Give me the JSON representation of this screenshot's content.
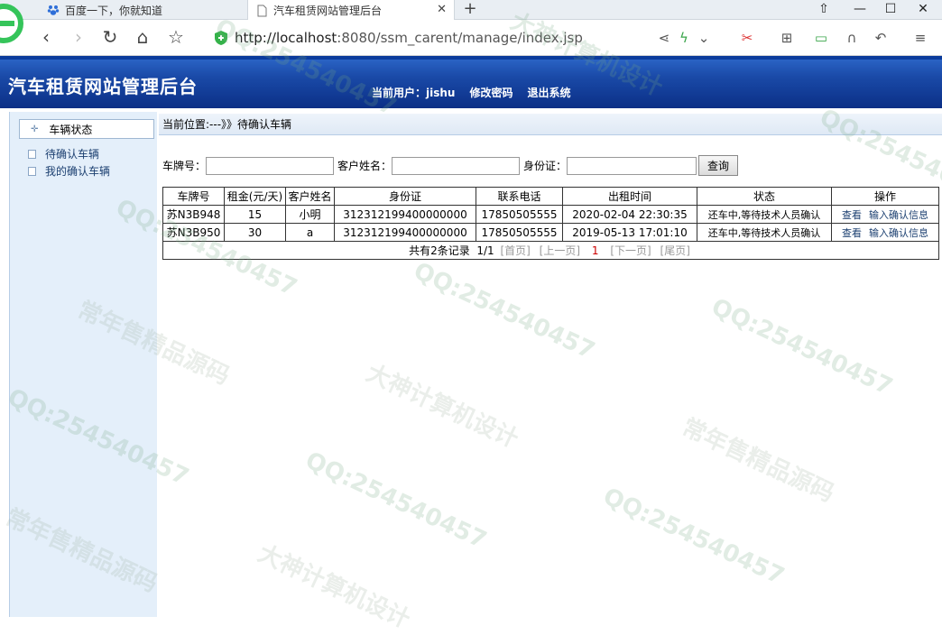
{
  "browser": {
    "tabs": [
      {
        "label": "百度一下，你就知道"
      },
      {
        "label": "汽车租赁网站管理后台"
      }
    ],
    "url": "http://localhost:8080/ssm_carent/manage/index.jsp",
    "url_host": "http://localhost",
    "url_rest": ":8080/ssm_carent/manage/index.jsp"
  },
  "header": {
    "title": "汽车租赁网站管理后台",
    "current_user_label": "当前用户：jishu",
    "change_password": "修改密码",
    "logout": "退出系统"
  },
  "sidebar": {
    "group_label": "车辆状态",
    "items": [
      {
        "label": "待确认车辆"
      },
      {
        "label": "我的确认车辆"
      }
    ]
  },
  "main": {
    "breadcrumb": "当前位置:---》》待确认车辆",
    "search": {
      "plate_label": "车牌号：",
      "customer_label": "客户姓名：",
      "idcard_label": "身份证：",
      "button": "查询"
    },
    "table": {
      "columns": [
        "车牌号",
        "租金(元/天)",
        "客户姓名",
        "身份证",
        "联系电话",
        "出租时间",
        "状态",
        "操作"
      ],
      "rows": [
        {
          "plate": "苏N3B948",
          "rent": "15",
          "name": "小明",
          "idcard": "312312199400000000",
          "phone": "17850505555",
          "time": "2020-02-04 22:30:35",
          "status": "还车中,等待技术人员确认",
          "view": "查看",
          "confirm": "输入确认信息"
        },
        {
          "plate": "苏N3B950",
          "rent": "30",
          "name": "a",
          "idcard": "312312199400000000",
          "phone": "17850505555",
          "time": "2019-05-13 17:01:10",
          "status": "还车中,等待技术人员确认",
          "view": "查看",
          "confirm": "输入确认信息"
        }
      ]
    },
    "pager": {
      "summary": "共有2条记录  1/1",
      "first": "[首页]",
      "prev": "[上一页]",
      "current": "1",
      "next": "[下一页]",
      "last": "[尾页]"
    }
  },
  "watermarks": {
    "qq": "QQ:254540457",
    "seller": "常年售精品源码",
    "designer": "大神计算机设计"
  }
}
